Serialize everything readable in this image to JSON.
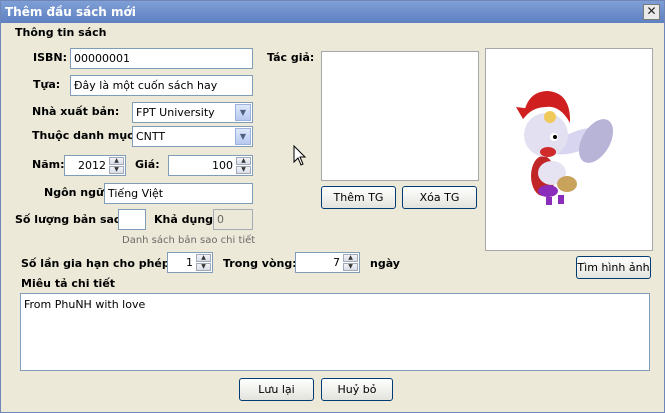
{
  "window": {
    "title": "Thêm đầu sách mới",
    "close_glyph": "✕"
  },
  "section": {
    "title": "Thông tin sách"
  },
  "fields": {
    "isbn": {
      "label": "ISBN:",
      "value": "00000001"
    },
    "title": {
      "label": "Tựa:",
      "value": "Đây là một cuốn sách hay"
    },
    "publisher": {
      "label": "Nhà xuất bản:",
      "value": "FPT University"
    },
    "category": {
      "label": "Thuộc danh mục:",
      "value": "CNTT"
    },
    "year": {
      "label": "Năm:",
      "value": "2012"
    },
    "price": {
      "label": "Giá:",
      "value": "100"
    },
    "language": {
      "label": "Ngôn ngữ",
      "value": "Tiếng Việt"
    },
    "copies": {
      "label": "Số lượng bản sao:",
      "value": ""
    },
    "available": {
      "label": "Khả dụng:",
      "value": "0"
    },
    "copies_link": "Danh sách bản sao chi tiết",
    "renewals": {
      "label": "Số lần gia hạn cho phép:",
      "value": "1"
    },
    "within": {
      "label": "Trong vòng:",
      "value": "7",
      "unit": "ngày"
    },
    "description": {
      "label": "Miêu tả chi tiết",
      "value": "From PhuNH with love"
    }
  },
  "authors": {
    "label": "Tác giả:",
    "add_button": "Thêm TG",
    "remove_button": "Xóa TG"
  },
  "image": {
    "find_button": "Tìm hình ảnh"
  },
  "footer": {
    "save_button": "Lưu lại",
    "cancel_button": "Huỷ bỏ"
  }
}
